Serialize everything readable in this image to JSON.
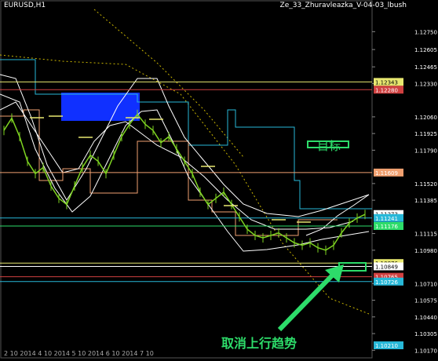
{
  "header": {
    "symbol": "EURUSD,H1",
    "indicator": "Ze_33_Zhuravleazka_V-04-03_lbush"
  },
  "annotations": {
    "target": "目标",
    "cancel_uptrend": "取消上行趋势"
  },
  "footer": {
    "dates": "2 10 2014  4 10 2014  5 10 2014  6 10 2014  7 10"
  },
  "colors": {
    "background": "#000000",
    "price": "#7ed321",
    "bands": "#ffffff",
    "channel": "#27b8d8",
    "step": "#f0a070",
    "annotation": "#2ddc6a",
    "box": "#1030ff",
    "dotted": "#c8b400"
  },
  "chart_data": {
    "type": "line",
    "title": "EURUSD,H1",
    "ylim": [
      1.1021,
      1.1293
    ],
    "yticks": [
      1.1275,
      1.12605,
      1.12465,
      1.1233,
      1.1206,
      1.11925,
      1.1179,
      1.1152,
      1.11385,
      1.11115,
      1.1098,
      1.1071,
      1.10575,
      1.1044,
      1.10305,
      1.1017
    ],
    "price_labels": [
      {
        "value": "1.12343",
        "color": "#e8e870"
      },
      {
        "value": "1.12280",
        "color": "#d04040"
      },
      {
        "value": "1.11609",
        "color": "#f0a070"
      },
      {
        "value": "1.11273",
        "color": "#ffffff"
      },
      {
        "value": "1.11241",
        "color": "#27b8d8"
      },
      {
        "value": "1.11176",
        "color": "#2ddc6a"
      },
      {
        "value": "1.10876",
        "color": "#e8e870"
      },
      {
        "value": "1.10849",
        "color": "#ffffff"
      },
      {
        "value": "1.10765",
        "color": "#d04040"
      },
      {
        "value": "1.10726",
        "color": "#27b8d8"
      },
      {
        "value": "1.10210",
        "color": "#27b8d8"
      }
    ],
    "series": [
      {
        "values": [
          1.1195,
          1.1205,
          1.119,
          1.117,
          1.116,
          1.1165,
          1.115,
          1.114,
          1.1135,
          1.115,
          1.1165,
          1.1175,
          1.117,
          1.116,
          1.1175,
          1.119,
          1.12,
          1.1208,
          1.12,
          1.1195,
          1.1185,
          1.119,
          1.118,
          1.117,
          1.116,
          1.1145,
          1.1135,
          1.114,
          1.1145,
          1.1135,
          1.1125,
          1.1115,
          1.111,
          1.1108,
          1.111,
          1.1112,
          1.1108,
          1.1104,
          1.1102,
          1.1104,
          1.11,
          1.1098,
          1.1102,
          1.1112,
          1.112,
          1.1124,
          1.1127
        ]
      }
    ]
  }
}
